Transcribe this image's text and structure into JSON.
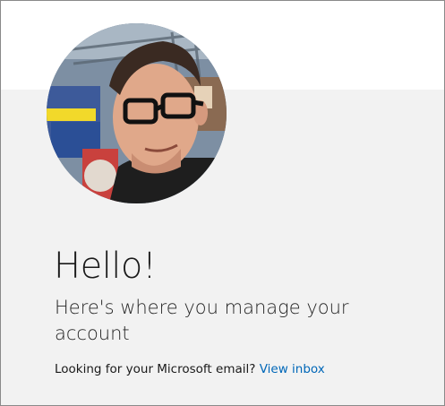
{
  "greeting": "Hello!",
  "subtitle": "Here's where you manage your account",
  "email_prompt": {
    "text": "Looking for your Microsoft email?",
    "link_label": "View inbox"
  },
  "colors": {
    "link": "#0067b8",
    "content_background": "#f2f2f2",
    "header_background": "#ffffff"
  },
  "icons": {
    "profile_picture": "user-avatar-photo"
  }
}
